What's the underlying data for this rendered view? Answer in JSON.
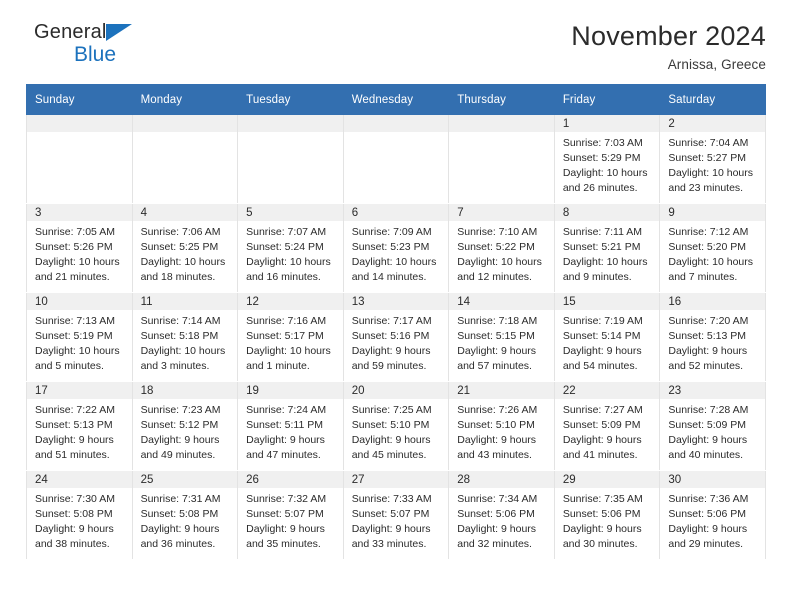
{
  "brand": {
    "name_dark": "General",
    "name_blue": "Blue",
    "accent_color": "#1c72bd"
  },
  "header": {
    "title": "November 2024",
    "subtitle": "Arnissa, Greece"
  },
  "colors": {
    "header_row": "#336fb0",
    "daynum_band": "#f0f0f0",
    "cell_border": "#e3e3e3",
    "text": "#2b2b2b"
  },
  "calendar": {
    "weekday_headers": [
      "Sunday",
      "Monday",
      "Tuesday",
      "Wednesday",
      "Thursday",
      "Friday",
      "Saturday"
    ],
    "weeks": [
      [
        {
          "day": "",
          "empty": true
        },
        {
          "day": "",
          "empty": true
        },
        {
          "day": "",
          "empty": true
        },
        {
          "day": "",
          "empty": true
        },
        {
          "day": "",
          "empty": true
        },
        {
          "day": "1",
          "sunrise": "Sunrise: 7:03 AM",
          "sunset": "Sunset: 5:29 PM",
          "daylight": "Daylight: 10 hours and 26 minutes."
        },
        {
          "day": "2",
          "sunrise": "Sunrise: 7:04 AM",
          "sunset": "Sunset: 5:27 PM",
          "daylight": "Daylight: 10 hours and 23 minutes."
        }
      ],
      [
        {
          "day": "3",
          "sunrise": "Sunrise: 7:05 AM",
          "sunset": "Sunset: 5:26 PM",
          "daylight": "Daylight: 10 hours and 21 minutes."
        },
        {
          "day": "4",
          "sunrise": "Sunrise: 7:06 AM",
          "sunset": "Sunset: 5:25 PM",
          "daylight": "Daylight: 10 hours and 18 minutes."
        },
        {
          "day": "5",
          "sunrise": "Sunrise: 7:07 AM",
          "sunset": "Sunset: 5:24 PM",
          "daylight": "Daylight: 10 hours and 16 minutes."
        },
        {
          "day": "6",
          "sunrise": "Sunrise: 7:09 AM",
          "sunset": "Sunset: 5:23 PM",
          "daylight": "Daylight: 10 hours and 14 minutes."
        },
        {
          "day": "7",
          "sunrise": "Sunrise: 7:10 AM",
          "sunset": "Sunset: 5:22 PM",
          "daylight": "Daylight: 10 hours and 12 minutes."
        },
        {
          "day": "8",
          "sunrise": "Sunrise: 7:11 AM",
          "sunset": "Sunset: 5:21 PM",
          "daylight": "Daylight: 10 hours and 9 minutes."
        },
        {
          "day": "9",
          "sunrise": "Sunrise: 7:12 AM",
          "sunset": "Sunset: 5:20 PM",
          "daylight": "Daylight: 10 hours and 7 minutes."
        }
      ],
      [
        {
          "day": "10",
          "sunrise": "Sunrise: 7:13 AM",
          "sunset": "Sunset: 5:19 PM",
          "daylight": "Daylight: 10 hours and 5 minutes."
        },
        {
          "day": "11",
          "sunrise": "Sunrise: 7:14 AM",
          "sunset": "Sunset: 5:18 PM",
          "daylight": "Daylight: 10 hours and 3 minutes."
        },
        {
          "day": "12",
          "sunrise": "Sunrise: 7:16 AM",
          "sunset": "Sunset: 5:17 PM",
          "daylight": "Daylight: 10 hours and 1 minute."
        },
        {
          "day": "13",
          "sunrise": "Sunrise: 7:17 AM",
          "sunset": "Sunset: 5:16 PM",
          "daylight": "Daylight: 9 hours and 59 minutes."
        },
        {
          "day": "14",
          "sunrise": "Sunrise: 7:18 AM",
          "sunset": "Sunset: 5:15 PM",
          "daylight": "Daylight: 9 hours and 57 minutes."
        },
        {
          "day": "15",
          "sunrise": "Sunrise: 7:19 AM",
          "sunset": "Sunset: 5:14 PM",
          "daylight": "Daylight: 9 hours and 54 minutes."
        },
        {
          "day": "16",
          "sunrise": "Sunrise: 7:20 AM",
          "sunset": "Sunset: 5:13 PM",
          "daylight": "Daylight: 9 hours and 52 minutes."
        }
      ],
      [
        {
          "day": "17",
          "sunrise": "Sunrise: 7:22 AM",
          "sunset": "Sunset: 5:13 PM",
          "daylight": "Daylight: 9 hours and 51 minutes."
        },
        {
          "day": "18",
          "sunrise": "Sunrise: 7:23 AM",
          "sunset": "Sunset: 5:12 PM",
          "daylight": "Daylight: 9 hours and 49 minutes."
        },
        {
          "day": "19",
          "sunrise": "Sunrise: 7:24 AM",
          "sunset": "Sunset: 5:11 PM",
          "daylight": "Daylight: 9 hours and 47 minutes."
        },
        {
          "day": "20",
          "sunrise": "Sunrise: 7:25 AM",
          "sunset": "Sunset: 5:10 PM",
          "daylight": "Daylight: 9 hours and 45 minutes."
        },
        {
          "day": "21",
          "sunrise": "Sunrise: 7:26 AM",
          "sunset": "Sunset: 5:10 PM",
          "daylight": "Daylight: 9 hours and 43 minutes."
        },
        {
          "day": "22",
          "sunrise": "Sunrise: 7:27 AM",
          "sunset": "Sunset: 5:09 PM",
          "daylight": "Daylight: 9 hours and 41 minutes."
        },
        {
          "day": "23",
          "sunrise": "Sunrise: 7:28 AM",
          "sunset": "Sunset: 5:09 PM",
          "daylight": "Daylight: 9 hours and 40 minutes."
        }
      ],
      [
        {
          "day": "24",
          "sunrise": "Sunrise: 7:30 AM",
          "sunset": "Sunset: 5:08 PM",
          "daylight": "Daylight: 9 hours and 38 minutes."
        },
        {
          "day": "25",
          "sunrise": "Sunrise: 7:31 AM",
          "sunset": "Sunset: 5:08 PM",
          "daylight": "Daylight: 9 hours and 36 minutes."
        },
        {
          "day": "26",
          "sunrise": "Sunrise: 7:32 AM",
          "sunset": "Sunset: 5:07 PM",
          "daylight": "Daylight: 9 hours and 35 minutes."
        },
        {
          "day": "27",
          "sunrise": "Sunrise: 7:33 AM",
          "sunset": "Sunset: 5:07 PM",
          "daylight": "Daylight: 9 hours and 33 minutes."
        },
        {
          "day": "28",
          "sunrise": "Sunrise: 7:34 AM",
          "sunset": "Sunset: 5:06 PM",
          "daylight": "Daylight: 9 hours and 32 minutes."
        },
        {
          "day": "29",
          "sunrise": "Sunrise: 7:35 AM",
          "sunset": "Sunset: 5:06 PM",
          "daylight": "Daylight: 9 hours and 30 minutes."
        },
        {
          "day": "30",
          "sunrise": "Sunrise: 7:36 AM",
          "sunset": "Sunset: 5:06 PM",
          "daylight": "Daylight: 9 hours and 29 minutes."
        }
      ]
    ]
  }
}
